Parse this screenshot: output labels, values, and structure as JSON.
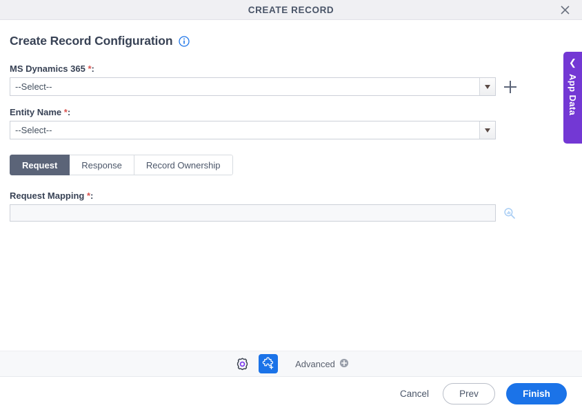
{
  "window": {
    "title": "CREATE RECORD",
    "close_icon": "close-icon"
  },
  "header": {
    "title": "Create Record Configuration",
    "info_icon": "info-icon"
  },
  "fields": {
    "connection": {
      "label": "MS Dynamics 365",
      "required_mark": "*",
      "colon": ":",
      "value": "--Select--",
      "add_icon": "plus-icon"
    },
    "entity": {
      "label": "Entity Name",
      "required_mark": "*",
      "colon": ":",
      "value": "--Select--"
    },
    "request_mapping": {
      "label": "Request Mapping",
      "required_mark": "*",
      "colon": ":",
      "value": "",
      "placeholder": "",
      "search_icon": "magnifier-icon"
    }
  },
  "tabs": [
    {
      "label": "Request",
      "active": true
    },
    {
      "label": "Response",
      "active": false
    },
    {
      "label": "Record Ownership",
      "active": false
    }
  ],
  "toolbar": {
    "settings_icon": "gear-icon",
    "extension_icon": "puzzle-plus-icon",
    "advanced_label": "Advanced",
    "advanced_add_icon": "circle-plus-icon"
  },
  "footer": {
    "cancel_label": "Cancel",
    "prev_label": "Prev",
    "finish_label": "Finish"
  },
  "side_panel": {
    "label": "App Data",
    "collapse_icon": "chevron-left-icon"
  },
  "colors": {
    "accent_blue": "#1b73e8",
    "tab_active": "#5b6478",
    "app_data_purple": "#7338d4",
    "required_red": "#d9534f",
    "titlebar_bg": "#f0f0f3"
  }
}
